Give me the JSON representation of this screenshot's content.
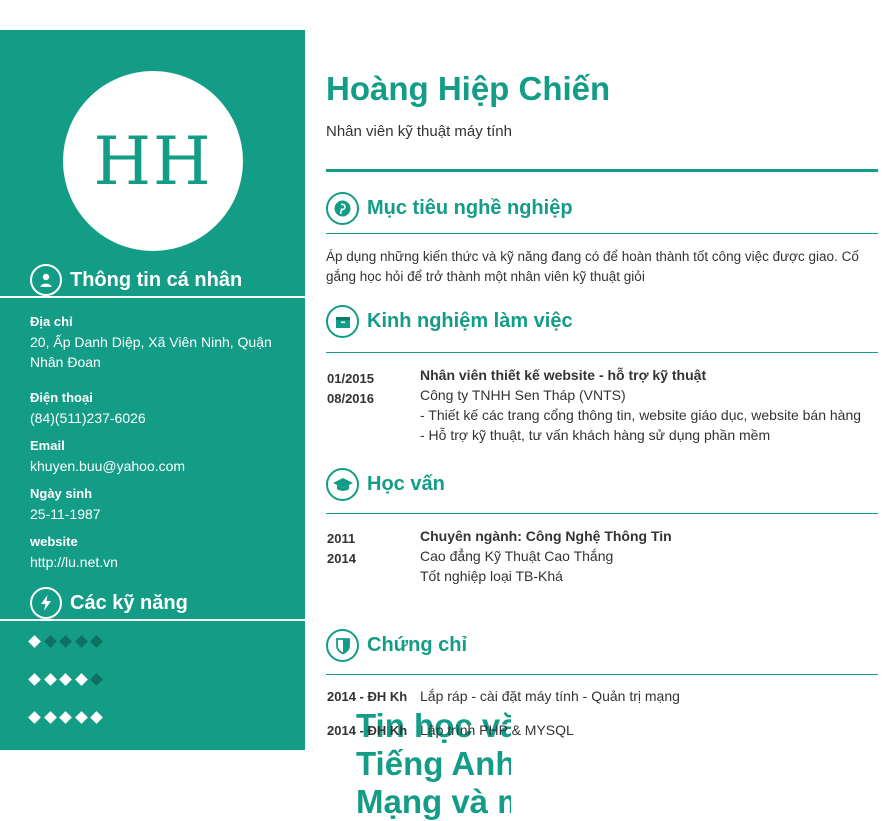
{
  "colors": {
    "accent": "#139c86",
    "sidebar_bg": "#139c86",
    "diamond_off": "#0f6f60"
  },
  "avatar": {
    "initials": "HH"
  },
  "sidebar": {
    "personal": {
      "title": "Thông tin cá nhân",
      "icon": "user-icon",
      "fields": [
        {
          "label": "Địa chỉ",
          "value": "20, Ấp Danh Diệp, Xã Viên Ninh, Quận Nhân Đoan"
        },
        {
          "label": "Điện thoại",
          "value": "(84)(511)237-6026"
        },
        {
          "label": "Email",
          "value": "khuyen.buu@yahoo.com"
        },
        {
          "label": "Ngày sinh",
          "value": "25-11-1987"
        },
        {
          "label": "website",
          "value": "http://lu.net.vn"
        }
      ]
    },
    "skills": {
      "title": "Các kỹ năng",
      "icon": "lightning-icon",
      "items": [
        {
          "name": "Tin học văn phòng",
          "level": 1,
          "max": 5
        },
        {
          "name": "Tiếng Anh",
          "level": 4,
          "max": 5
        },
        {
          "name": "Mạng và máy tính",
          "level": 5,
          "max": 5
        }
      ]
    }
  },
  "header": {
    "name": "Hoàng Hiệp Chiến",
    "position": "Nhân viên kỹ thuật máy tính"
  },
  "objective": {
    "title": "Mục tiêu nghề nghiệp",
    "icon": "target-icon",
    "text": "Áp dụng những kiến thức và kỹ năng đang có để hoàn thành tốt công việc được giao. Cố gắng học hỏi để trở thành một nhân viên kỹ thuật giỏi"
  },
  "experience": {
    "title": "Kinh nghiệm làm việc",
    "icon": "briefcase-icon",
    "items": [
      {
        "start": "01/2015",
        "end": "08/2016",
        "role": "Nhân viên thiết kế website - hỗ trợ kỹ thuật",
        "company": "Công ty TNHH Sen Tháp (VNTS)",
        "details": [
          "- Thiết kế các trang cổng thông tin, website giáo dục, website bán hàng",
          "- Hỗ trợ kỹ thuật, tư vấn khách hàng sử dụng phần mềm"
        ]
      }
    ]
  },
  "education": {
    "title": "Học vấn",
    "icon": "graduation-cap-icon",
    "items": [
      {
        "start": "2011",
        "end": "2014",
        "major": "Chuyên ngành: Công Nghệ Thông Tin",
        "school": "Cao đẳng Kỹ Thuật Cao Thắng",
        "result": "Tốt nghiệp loại TB-Khá"
      }
    ]
  },
  "certificates": {
    "title": "Chứng chỉ",
    "icon": "shield-icon",
    "items": [
      {
        "date": "2014 - ĐH Kh",
        "name": "Lắp ráp - cài đặt máy tính - Quản trị mạng"
      },
      {
        "date": "2014 - ĐH Kh",
        "name": "Lập trình PHP & MYSQL"
      }
    ]
  }
}
